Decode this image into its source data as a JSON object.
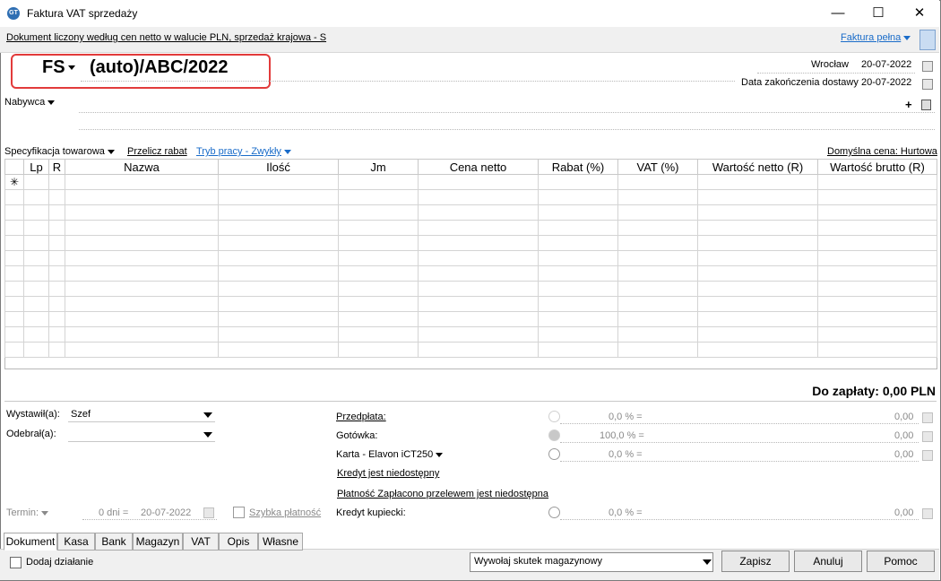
{
  "window": {
    "title": "Faktura VAT sprzedaży",
    "minimize": "—",
    "maximize": "☐",
    "close": "✕"
  },
  "topbar": {
    "info_link": "Dokument liczony według cen netto w walucie PLN, sprzedaż krajowa - S",
    "mode_link": "Faktura pełna"
  },
  "document": {
    "series": "FS",
    "number": "(auto)/ABC/2022"
  },
  "place": {
    "city": "Wrocław",
    "date": "20-07-2022",
    "delivery_label": "Data zakończenia dostawy",
    "delivery_date": "20-07-2022"
  },
  "buyer": {
    "label": "Nabywca",
    "add": "+"
  },
  "spec": {
    "label": "Specyfikacja towarowa",
    "recalc": "Przelicz rabat",
    "work_mode": "Tryb pracy - Zwykły",
    "default_price": "Domyślna cena: Hurtowa"
  },
  "grid": {
    "columns": [
      "",
      "Lp",
      "R",
      "Nazwa",
      "Ilość",
      "Jm",
      "Cena netto",
      "Rabat (%)",
      "VAT (%)",
      "Wartość netto (R)",
      "Wartość brutto (R)"
    ],
    "new_row_marker": "✳"
  },
  "total": {
    "label": "Do zapłaty: 0,00 PLN"
  },
  "issuer": {
    "label": "Wystawił(a):",
    "value": "Szef"
  },
  "receiver": {
    "label": "Odebrał(a):",
    "value": ""
  },
  "term": {
    "label": "Termin:",
    "days": "0 dni =",
    "date": "20-07-2022",
    "fast_payment": "Szybka płatność"
  },
  "payments": {
    "prepayment": {
      "label": "Przedpłata:",
      "percent": "0,0 % =",
      "amount": "0,00"
    },
    "cash": {
      "label": "Gotówka:",
      "percent": "100,0 % =",
      "amount": "0,00"
    },
    "card": {
      "label": "Karta - Elavon iCT250",
      "percent": "0,0 % =",
      "amount": "0,00"
    },
    "credit_unavailable": "Kredyt jest niedostępny",
    "transfer_unavailable": "Płatność Zapłacono przelewem jest niedostępna",
    "merchant_credit": {
      "label": "Kredyt kupiecki:",
      "percent": "0,0 % =",
      "amount": "0,00"
    }
  },
  "tabs": [
    "Dokument",
    "Kasa",
    "Bank",
    "Magazyn",
    "VAT",
    "Opis",
    "Własne"
  ],
  "bottom": {
    "add_action": "Dodaj działanie",
    "warehouse_effect": "Wywołaj skutek magazynowy",
    "save": "Zapisz",
    "cancel": "Anuluj",
    "help": "Pomoc"
  }
}
